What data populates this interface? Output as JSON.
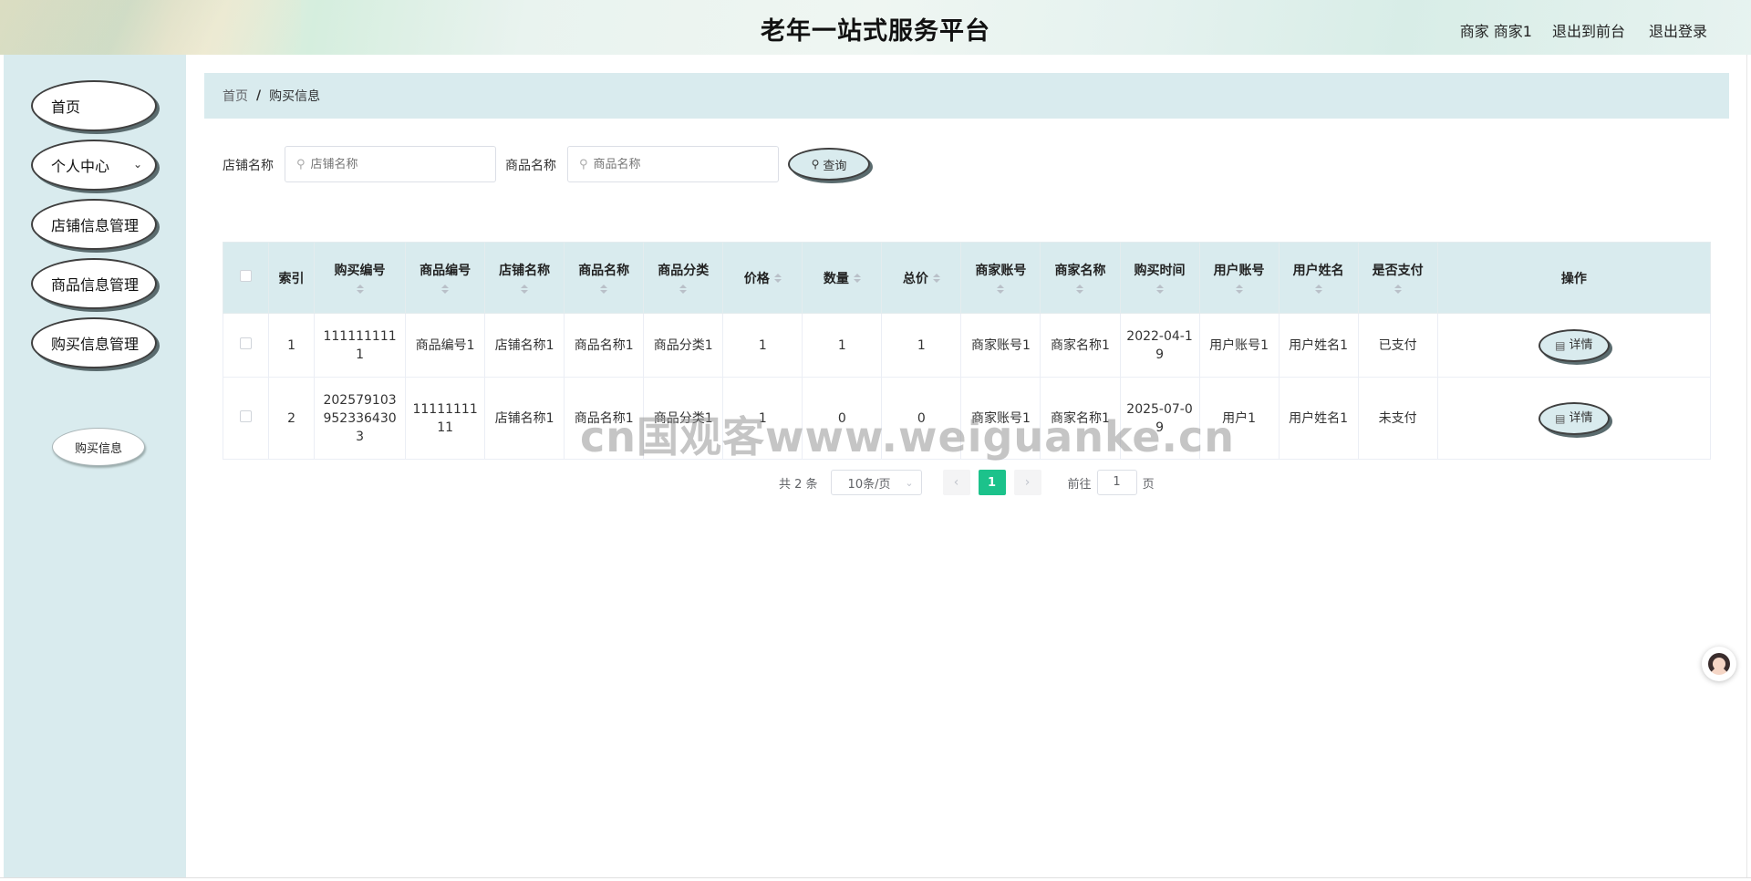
{
  "header": {
    "title": "老年一站式服务平台",
    "user": "商家 商家1",
    "back_to_front": "退出到前台",
    "logout": "退出登录"
  },
  "sidebar": {
    "items": [
      {
        "label": "首页"
      },
      {
        "label": "个人中心"
      },
      {
        "label": "店铺信息管理"
      },
      {
        "label": "商品信息管理"
      },
      {
        "label": "购买信息管理"
      }
    ],
    "sub_item": "购买信息"
  },
  "breadcrumb": {
    "home": "首页",
    "separator": "/",
    "current": "购买信息"
  },
  "search": {
    "shop_label": "店铺名称",
    "shop_placeholder": "店铺名称",
    "product_label": "商品名称",
    "product_placeholder": "商品名称",
    "query_button": "查询"
  },
  "table": {
    "headers": [
      "索引",
      "购买编号",
      "商品编号",
      "店铺名称",
      "商品名称",
      "商品分类",
      "价格",
      "数量",
      "总价",
      "商家账号",
      "商家名称",
      "购买时间",
      "用户账号",
      "用户姓名",
      "是否支付",
      "操作"
    ],
    "rows": [
      [
        "1",
        "1111111111",
        "商品编号1",
        "店铺名称1",
        "商品名称1",
        "商品分类1",
        "1",
        "1",
        "1",
        "商家账号1",
        "商家名称1",
        "2022-04-19",
        "用户账号1",
        "用户姓名1",
        "已支付"
      ],
      [
        "2",
        "2025791039523364303",
        "1111111111",
        "店铺名称1",
        "商品名称1",
        "商品分类1",
        "1",
        "0",
        "0",
        "商家账号1",
        "商家名称1",
        "2025-07-09",
        "用户1",
        "用户姓名1",
        "未支付"
      ]
    ],
    "detail_button": "详情"
  },
  "pagination": {
    "total": "共 2 条",
    "page_size": "10条/页",
    "current_page": "1",
    "goto_label": "前往",
    "goto_value": "1",
    "page_suffix": "页"
  },
  "watermark": "cn国观客www.weiguanke.cn",
  "colors": {
    "accent": "#1cc28b",
    "panel": "#d9ebee"
  }
}
